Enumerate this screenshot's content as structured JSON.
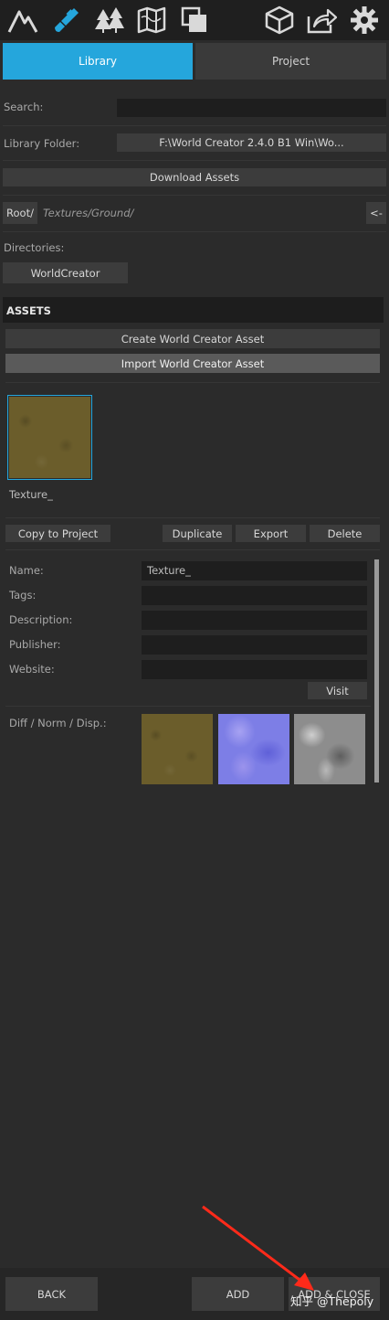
{
  "toolbar": {
    "icons": [
      "terrain-icon",
      "brush-icon",
      "trees-icon",
      "map-icon",
      "layers-icon",
      "cube-icon",
      "share-icon",
      "gear-icon"
    ]
  },
  "tabs": {
    "library": "Library",
    "project": "Project"
  },
  "search": {
    "label": "Search:",
    "value": ""
  },
  "library_folder": {
    "label": "Library Folder:",
    "value": "F:\\World Creator 2.4.0 B1 Win\\Wo..."
  },
  "download_assets": "Download Assets",
  "path": {
    "root": "Root/",
    "current": "Textures/Ground/",
    "back": "<-"
  },
  "directories": {
    "label": "Directories:",
    "items": [
      "WorldCreator"
    ]
  },
  "assets": {
    "header": "ASSETS",
    "create": "Create World Creator Asset",
    "import": "Import World Creator Asset",
    "items": [
      {
        "name": "Texture_"
      }
    ]
  },
  "actions": {
    "copy": "Copy to Project",
    "duplicate": "Duplicate",
    "export": "Export",
    "delete": "Delete"
  },
  "details": {
    "name_label": "Name:",
    "name_value": "Texture_",
    "tags_label": "Tags:",
    "tags_value": "",
    "description_label": "Description:",
    "description_value": "",
    "publisher_label": "Publisher:",
    "publisher_value": "",
    "website_label": "Website:",
    "website_value": "",
    "visit": "Visit",
    "maps_label": "Diff / Norm / Disp.:"
  },
  "footer": {
    "back": "BACK",
    "add": "ADD",
    "add_close": "ADD & CLOSE"
  },
  "watermark": "知乎 @Thepoly",
  "colors": {
    "accent": "#25a6dc",
    "background": "#2b2b2b",
    "annotation_arrow": "#ff2a1a"
  }
}
